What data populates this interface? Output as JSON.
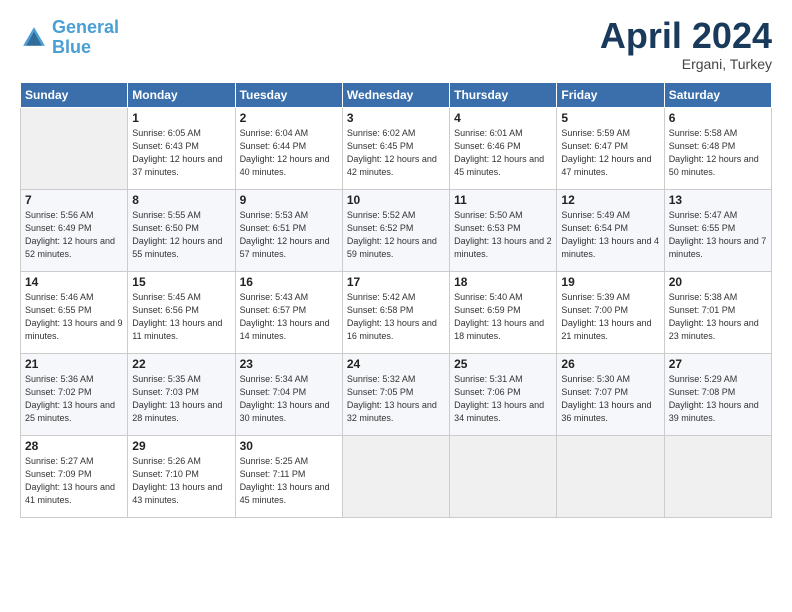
{
  "header": {
    "logo_line1": "General",
    "logo_line2": "Blue",
    "month": "April 2024",
    "location": "Ergani, Turkey"
  },
  "days_of_week": [
    "Sunday",
    "Monday",
    "Tuesday",
    "Wednesday",
    "Thursday",
    "Friday",
    "Saturday"
  ],
  "weeks": [
    [
      {
        "day": "",
        "sunrise": "",
        "sunset": "",
        "daylight": ""
      },
      {
        "day": "1",
        "sunrise": "Sunrise: 6:05 AM",
        "sunset": "Sunset: 6:43 PM",
        "daylight": "Daylight: 12 hours and 37 minutes."
      },
      {
        "day": "2",
        "sunrise": "Sunrise: 6:04 AM",
        "sunset": "Sunset: 6:44 PM",
        "daylight": "Daylight: 12 hours and 40 minutes."
      },
      {
        "day": "3",
        "sunrise": "Sunrise: 6:02 AM",
        "sunset": "Sunset: 6:45 PM",
        "daylight": "Daylight: 12 hours and 42 minutes."
      },
      {
        "day": "4",
        "sunrise": "Sunrise: 6:01 AM",
        "sunset": "Sunset: 6:46 PM",
        "daylight": "Daylight: 12 hours and 45 minutes."
      },
      {
        "day": "5",
        "sunrise": "Sunrise: 5:59 AM",
        "sunset": "Sunset: 6:47 PM",
        "daylight": "Daylight: 12 hours and 47 minutes."
      },
      {
        "day": "6",
        "sunrise": "Sunrise: 5:58 AM",
        "sunset": "Sunset: 6:48 PM",
        "daylight": "Daylight: 12 hours and 50 minutes."
      }
    ],
    [
      {
        "day": "7",
        "sunrise": "Sunrise: 5:56 AM",
        "sunset": "Sunset: 6:49 PM",
        "daylight": "Daylight: 12 hours and 52 minutes."
      },
      {
        "day": "8",
        "sunrise": "Sunrise: 5:55 AM",
        "sunset": "Sunset: 6:50 PM",
        "daylight": "Daylight: 12 hours and 55 minutes."
      },
      {
        "day": "9",
        "sunrise": "Sunrise: 5:53 AM",
        "sunset": "Sunset: 6:51 PM",
        "daylight": "Daylight: 12 hours and 57 minutes."
      },
      {
        "day": "10",
        "sunrise": "Sunrise: 5:52 AM",
        "sunset": "Sunset: 6:52 PM",
        "daylight": "Daylight: 12 hours and 59 minutes."
      },
      {
        "day": "11",
        "sunrise": "Sunrise: 5:50 AM",
        "sunset": "Sunset: 6:53 PM",
        "daylight": "Daylight: 13 hours and 2 minutes."
      },
      {
        "day": "12",
        "sunrise": "Sunrise: 5:49 AM",
        "sunset": "Sunset: 6:54 PM",
        "daylight": "Daylight: 13 hours and 4 minutes."
      },
      {
        "day": "13",
        "sunrise": "Sunrise: 5:47 AM",
        "sunset": "Sunset: 6:55 PM",
        "daylight": "Daylight: 13 hours and 7 minutes."
      }
    ],
    [
      {
        "day": "14",
        "sunrise": "Sunrise: 5:46 AM",
        "sunset": "Sunset: 6:55 PM",
        "daylight": "Daylight: 13 hours and 9 minutes."
      },
      {
        "day": "15",
        "sunrise": "Sunrise: 5:45 AM",
        "sunset": "Sunset: 6:56 PM",
        "daylight": "Daylight: 13 hours and 11 minutes."
      },
      {
        "day": "16",
        "sunrise": "Sunrise: 5:43 AM",
        "sunset": "Sunset: 6:57 PM",
        "daylight": "Daylight: 13 hours and 14 minutes."
      },
      {
        "day": "17",
        "sunrise": "Sunrise: 5:42 AM",
        "sunset": "Sunset: 6:58 PM",
        "daylight": "Daylight: 13 hours and 16 minutes."
      },
      {
        "day": "18",
        "sunrise": "Sunrise: 5:40 AM",
        "sunset": "Sunset: 6:59 PM",
        "daylight": "Daylight: 13 hours and 18 minutes."
      },
      {
        "day": "19",
        "sunrise": "Sunrise: 5:39 AM",
        "sunset": "Sunset: 7:00 PM",
        "daylight": "Daylight: 13 hours and 21 minutes."
      },
      {
        "day": "20",
        "sunrise": "Sunrise: 5:38 AM",
        "sunset": "Sunset: 7:01 PM",
        "daylight": "Daylight: 13 hours and 23 minutes."
      }
    ],
    [
      {
        "day": "21",
        "sunrise": "Sunrise: 5:36 AM",
        "sunset": "Sunset: 7:02 PM",
        "daylight": "Daylight: 13 hours and 25 minutes."
      },
      {
        "day": "22",
        "sunrise": "Sunrise: 5:35 AM",
        "sunset": "Sunset: 7:03 PM",
        "daylight": "Daylight: 13 hours and 28 minutes."
      },
      {
        "day": "23",
        "sunrise": "Sunrise: 5:34 AM",
        "sunset": "Sunset: 7:04 PM",
        "daylight": "Daylight: 13 hours and 30 minutes."
      },
      {
        "day": "24",
        "sunrise": "Sunrise: 5:32 AM",
        "sunset": "Sunset: 7:05 PM",
        "daylight": "Daylight: 13 hours and 32 minutes."
      },
      {
        "day": "25",
        "sunrise": "Sunrise: 5:31 AM",
        "sunset": "Sunset: 7:06 PM",
        "daylight": "Daylight: 13 hours and 34 minutes."
      },
      {
        "day": "26",
        "sunrise": "Sunrise: 5:30 AM",
        "sunset": "Sunset: 7:07 PM",
        "daylight": "Daylight: 13 hours and 36 minutes."
      },
      {
        "day": "27",
        "sunrise": "Sunrise: 5:29 AM",
        "sunset": "Sunset: 7:08 PM",
        "daylight": "Daylight: 13 hours and 39 minutes."
      }
    ],
    [
      {
        "day": "28",
        "sunrise": "Sunrise: 5:27 AM",
        "sunset": "Sunset: 7:09 PM",
        "daylight": "Daylight: 13 hours and 41 minutes."
      },
      {
        "day": "29",
        "sunrise": "Sunrise: 5:26 AM",
        "sunset": "Sunset: 7:10 PM",
        "daylight": "Daylight: 13 hours and 43 minutes."
      },
      {
        "day": "30",
        "sunrise": "Sunrise: 5:25 AM",
        "sunset": "Sunset: 7:11 PM",
        "daylight": "Daylight: 13 hours and 45 minutes."
      },
      {
        "day": "",
        "sunrise": "",
        "sunset": "",
        "daylight": ""
      },
      {
        "day": "",
        "sunrise": "",
        "sunset": "",
        "daylight": ""
      },
      {
        "day": "",
        "sunrise": "",
        "sunset": "",
        "daylight": ""
      },
      {
        "day": "",
        "sunrise": "",
        "sunset": "",
        "daylight": ""
      }
    ]
  ]
}
